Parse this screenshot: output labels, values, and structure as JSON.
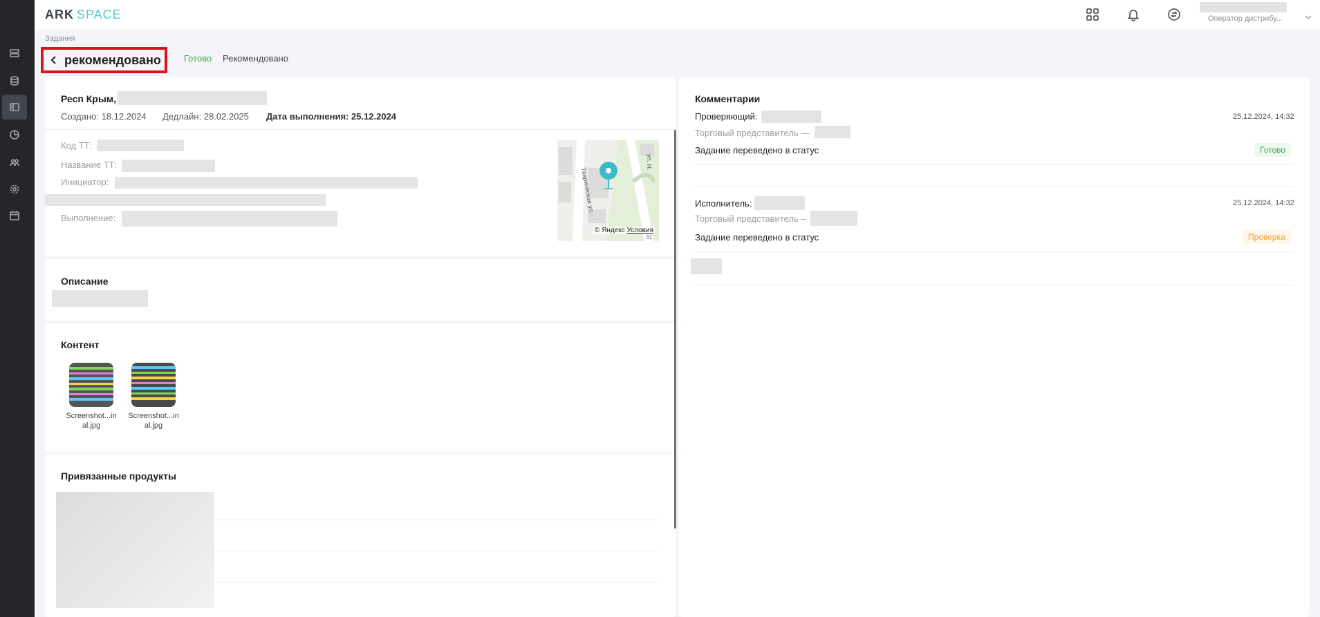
{
  "logo": {
    "part1": "ARK",
    "part2": "SPACE"
  },
  "sidebar": {
    "items": [
      {
        "name": "list-icon",
        "active": false
      },
      {
        "name": "database-icon",
        "active": false
      },
      {
        "name": "tasks-icon",
        "active": true
      },
      {
        "name": "chart-icon",
        "active": false
      },
      {
        "name": "users-icon",
        "active": false
      },
      {
        "name": "settings-icon",
        "active": false
      },
      {
        "name": "calendar-icon",
        "active": false
      }
    ]
  },
  "header": {
    "icons": [
      "apps-grid-icon",
      "bell-icon",
      "exchange-icon"
    ],
    "user_role": "Оператор дистрибу..."
  },
  "breadcrumb": "Задания",
  "page": {
    "title": "рекомендовано",
    "status_done": "Готово",
    "status_recommended": "Рекомендовано"
  },
  "task": {
    "region": "Респ Крым,",
    "created_label": "Создано: 18.12.2024",
    "deadline_label": "Дедлайн: 28.02.2025",
    "completed_label": "Дата выполнения: 25.12.2024",
    "tt_code_label": "Код ТТ:",
    "tt_name_label": "Название ТТ:",
    "initiator_label": "Инициатор:",
    "execution_label": "Выполнение:",
    "map_attribution": "© Яндекс",
    "map_terms": "Условия",
    "map_street": "Таврическая ул.",
    "map_street2": "ул. Н.",
    "map_house": "31"
  },
  "description": {
    "title": "Описание"
  },
  "content": {
    "title": "Контент",
    "files": [
      {
        "name_line1": "Screenshot...in",
        "name_line2": "al.jpg"
      },
      {
        "name_line1": "Screenshot...in",
        "name_line2": "al.jpg"
      }
    ]
  },
  "products": {
    "title": "Привязанные продукты"
  },
  "comments": {
    "title": "Комментарии",
    "items": [
      {
        "role_label": "Проверяющий:",
        "time": "25.12.2024, 14:32",
        "sub_label": "Торговый представитель —",
        "text": "Задание переведено в статус",
        "status": "Готово"
      },
      {
        "role_label": "Исполнитель:",
        "time": "25.12.2024, 14:32",
        "sub_label": "Торговый представитель –",
        "text": "Задание переведено в статус",
        "status": "Проверка"
      }
    ]
  },
  "colors": {
    "accent_green": "#3aa64a",
    "accent_orange": "#f0a030",
    "highlight_red": "#d9141b",
    "sidebar_bg": "#25262b",
    "map_pin": "#3bbac5"
  }
}
